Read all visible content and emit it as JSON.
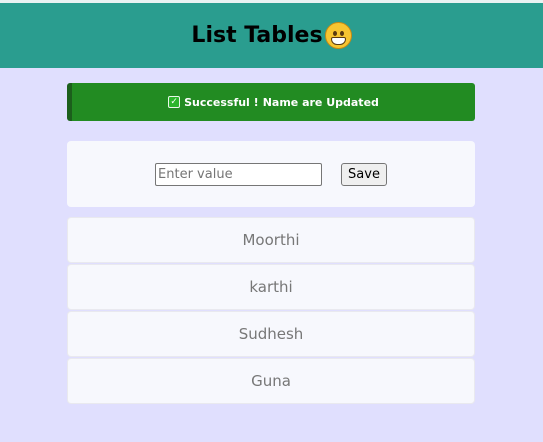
{
  "header": {
    "title": "List Tables",
    "emoji": "grinning-face-icon"
  },
  "alert": {
    "strong": "Successful !",
    "message": "Name are Updated",
    "color": "#228b22"
  },
  "form": {
    "input_value": "",
    "input_placeholder": "Enter value",
    "save_label": "Save"
  },
  "list": {
    "items": [
      {
        "label": "Moorthi"
      },
      {
        "label": "karthi"
      },
      {
        "label": "Sudhesh"
      },
      {
        "label": "Guna"
      }
    ]
  },
  "colors": {
    "header_bg": "#2a9d8f",
    "page_bg": "#e0dffe",
    "card_bg": "#f7f8fd"
  }
}
